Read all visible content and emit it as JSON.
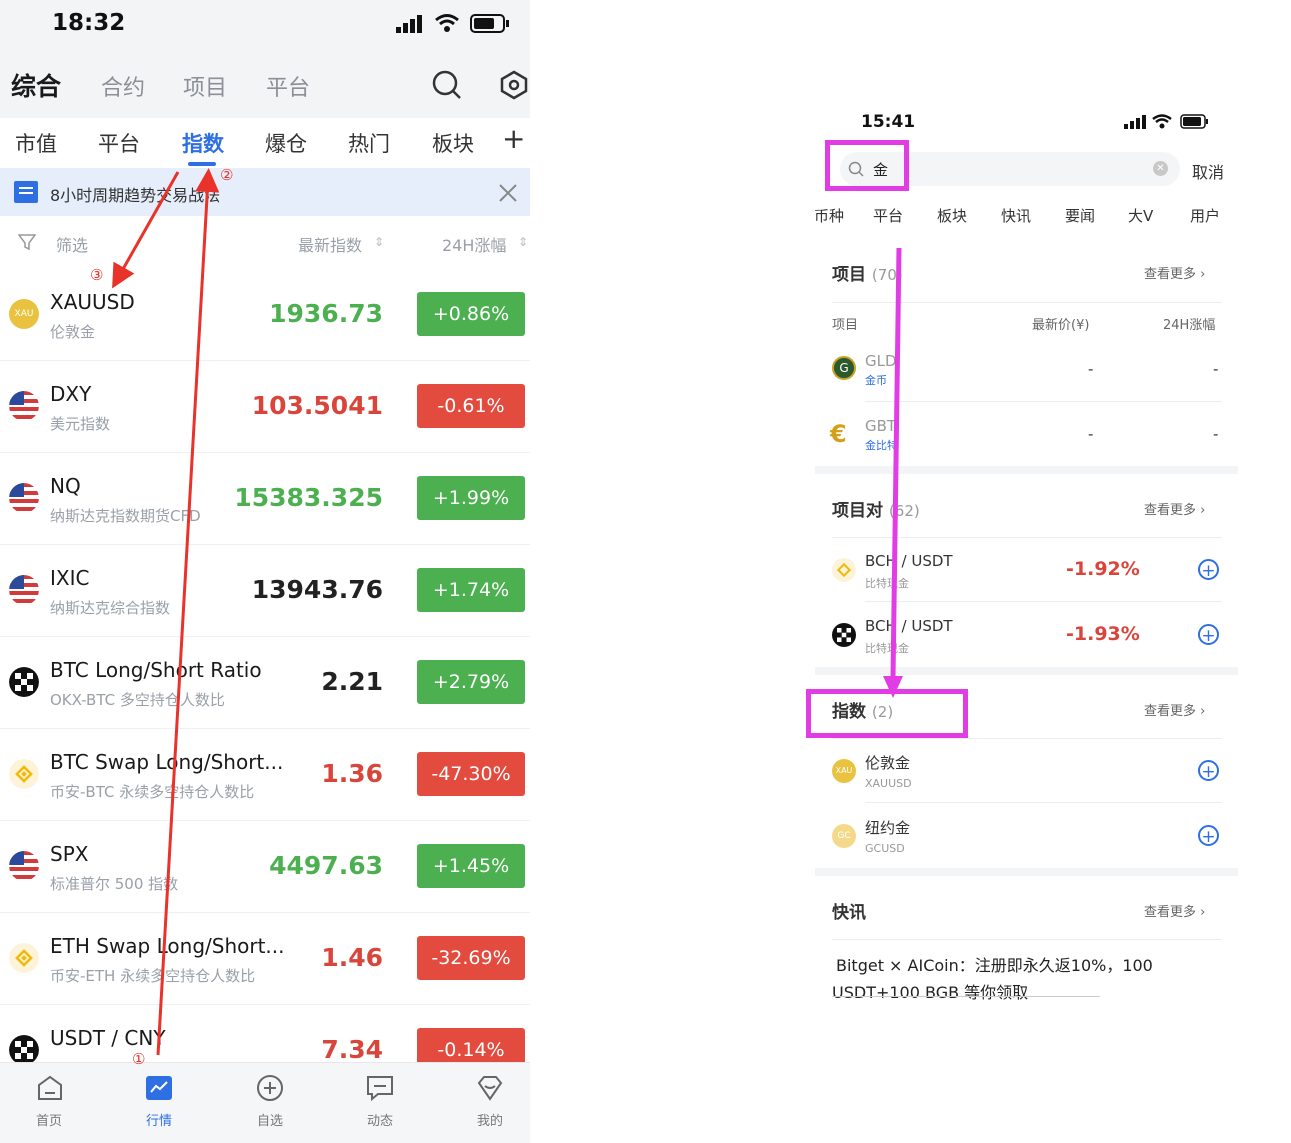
{
  "left": {
    "status": {
      "time": "18:32"
    },
    "main_tabs": [
      "综合",
      "合约",
      "项目",
      "平台"
    ],
    "sub_tabs": [
      "市值",
      "平台",
      "指数",
      "爆仓",
      "热门",
      "板块"
    ],
    "sub_tabs_plus": "+",
    "banner": "8小时周期趋势交易战法",
    "filter": {
      "filter_label": "筛选",
      "col_price": "最新指数",
      "col_change": "24H涨幅"
    },
    "rows": [
      {
        "symbol": "XAUUSD",
        "name": "伦敦金",
        "price": "1936.73",
        "change": "+0.86%",
        "dir": "up",
        "icon": "xau-coin-icon",
        "icon_text": "XAU"
      },
      {
        "symbol": "DXY",
        "name": "美元指数",
        "price": "103.5041",
        "change": "-0.61%",
        "dir": "down",
        "icon": "us-flag-icon"
      },
      {
        "symbol": "NQ",
        "name": "纳斯达克指数期货CFD",
        "price": "15383.325",
        "change": "+1.99%",
        "dir": "up",
        "icon": "us-flag-icon"
      },
      {
        "symbol": "IXIC",
        "name": "纳斯达克综合指数",
        "price": "13943.76",
        "change": "+1.74%",
        "dir": "up",
        "neutral": true,
        "icon": "us-flag-icon"
      },
      {
        "symbol": "BTC Long/Short Ratio",
        "name": "OKX-BTC 多空持仓人数比",
        "price": "2.21",
        "change": "+2.79%",
        "dir": "up",
        "neutral": true,
        "icon": "okx-icon"
      },
      {
        "symbol": "BTC Swap Long/Short...",
        "name": "币安-BTC 永续多空持仓人数比",
        "price": "1.36",
        "change": "-47.30%",
        "dir": "down",
        "icon": "binance-icon"
      },
      {
        "symbol": "SPX",
        "name": "标准普尔 500 指数",
        "price": "4497.63",
        "change": "+1.45%",
        "dir": "up",
        "icon": "us-flag-icon"
      },
      {
        "symbol": "ETH Swap Long/Short...",
        "name": "币安-ETH 永续多空持仓人数比",
        "price": "1.46",
        "change": "-32.69%",
        "dir": "down",
        "icon": "binance-icon"
      },
      {
        "symbol": "USDT / CNY",
        "name": "",
        "price": "7.34",
        "change": "-0.14%",
        "dir": "down",
        "icon": "okx-icon"
      }
    ],
    "bottom_nav": [
      "首页",
      "行情",
      "自选",
      "动态",
      "我的"
    ],
    "annotations": {
      "one": "①",
      "two": "②",
      "three": "③"
    }
  },
  "right": {
    "status": {
      "time": "15:41"
    },
    "search": {
      "value": "金",
      "cancel": "取消"
    },
    "tabs": [
      "币种",
      "平台",
      "板块",
      "快讯",
      "要闻",
      "大V",
      "用户"
    ],
    "projects": {
      "title": "项目",
      "count": "(70)",
      "more": "查看更多",
      "col_item": "项目",
      "col_price": "最新价(¥)",
      "col_change": "24H涨幅",
      "items": [
        {
          "symbol": "GLD",
          "name": "金币",
          "price": "-",
          "change": "-"
        },
        {
          "symbol": "GBT",
          "name": "金比特",
          "price": "-",
          "change": "-"
        }
      ]
    },
    "pairs": {
      "title": "项目对",
      "count": "(62)",
      "more": "查看更多",
      "items": [
        {
          "symbol": "BCH / USDT",
          "name": "比特现金",
          "change": "-1.92%"
        },
        {
          "symbol": "BCH / USDT",
          "name": "比特现金",
          "change": "-1.93%"
        }
      ]
    },
    "indices": {
      "title": "指数",
      "count": "(2)",
      "more": "查看更多",
      "items": [
        {
          "name": "伦敦金",
          "symbol": "XAUUSD",
          "icon_text": "XAU"
        },
        {
          "name": "纽约金",
          "symbol": "GCUSD",
          "icon_text": "GC"
        }
      ]
    },
    "news": {
      "title": "快讯",
      "more": "查看更多",
      "text_line1": "Bitget × AICoin：注册即永久返10%，100",
      "text_line2": "USDT+100 BGB 等你领取"
    }
  },
  "colors": {
    "accent": "#2f6fe4",
    "up": "#4caf50",
    "down": "#e34b3e",
    "annotation_red": "#e8322a",
    "highlight": "#e23ce5"
  }
}
